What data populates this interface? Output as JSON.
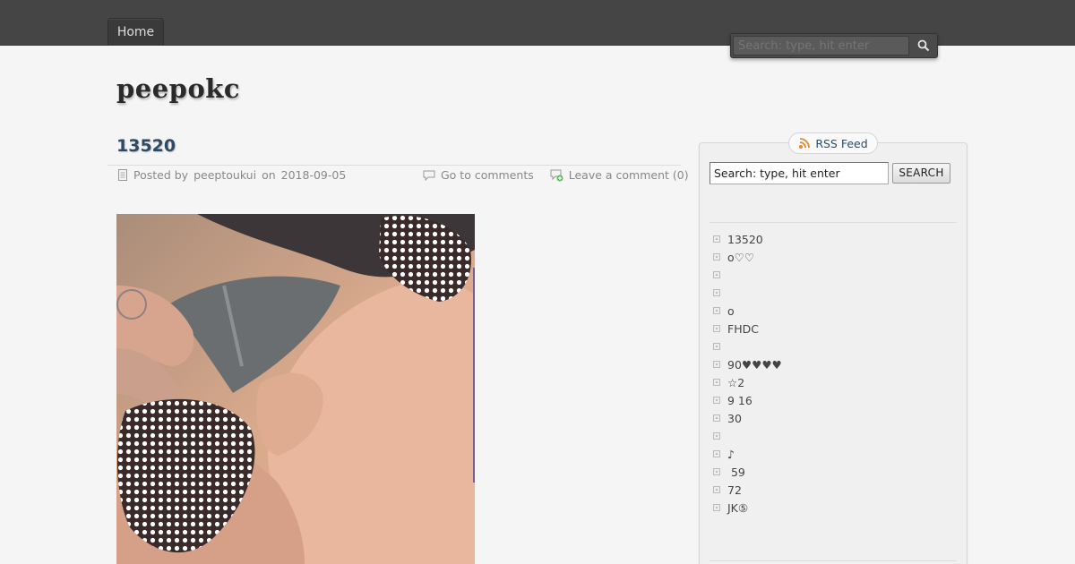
{
  "nav": {
    "home_label": "Home"
  },
  "top_search": {
    "placeholder": "Search: type, hit enter"
  },
  "site": {
    "title": "peepokc"
  },
  "post": {
    "title": "13520",
    "posted_by_prefix": "Posted by",
    "author": "peeptoukui",
    "on_word": "on",
    "date": "2018-09-05",
    "comments_link": "Go to comments",
    "leave_comment": "Leave a comment (0)"
  },
  "sidebar": {
    "rss_label": "RSS Feed",
    "search_value": "Search: type, hit enter",
    "search_button": "SEARCH",
    "recent_posts": [
      "13520",
      "o♡♡",
      "",
      "",
      "o",
      "FHDC",
      "",
      "90♥♥♥♥",
      "☆2",
      "9 16",
      "30",
      "",
      "♪",
      " 59",
      "72",
      "JK⑤"
    ]
  },
  "colors": {
    "topbar": "#454545",
    "title_link": "#2f4a64",
    "rss_orange": "#e8892b"
  },
  "icons": {
    "search": "magnifier-icon",
    "rss": "rss-icon",
    "posted": "document-icon",
    "comments": "comment-icon",
    "add_comment": "comment-add-icon",
    "bullet": "square-bullet-icon"
  }
}
